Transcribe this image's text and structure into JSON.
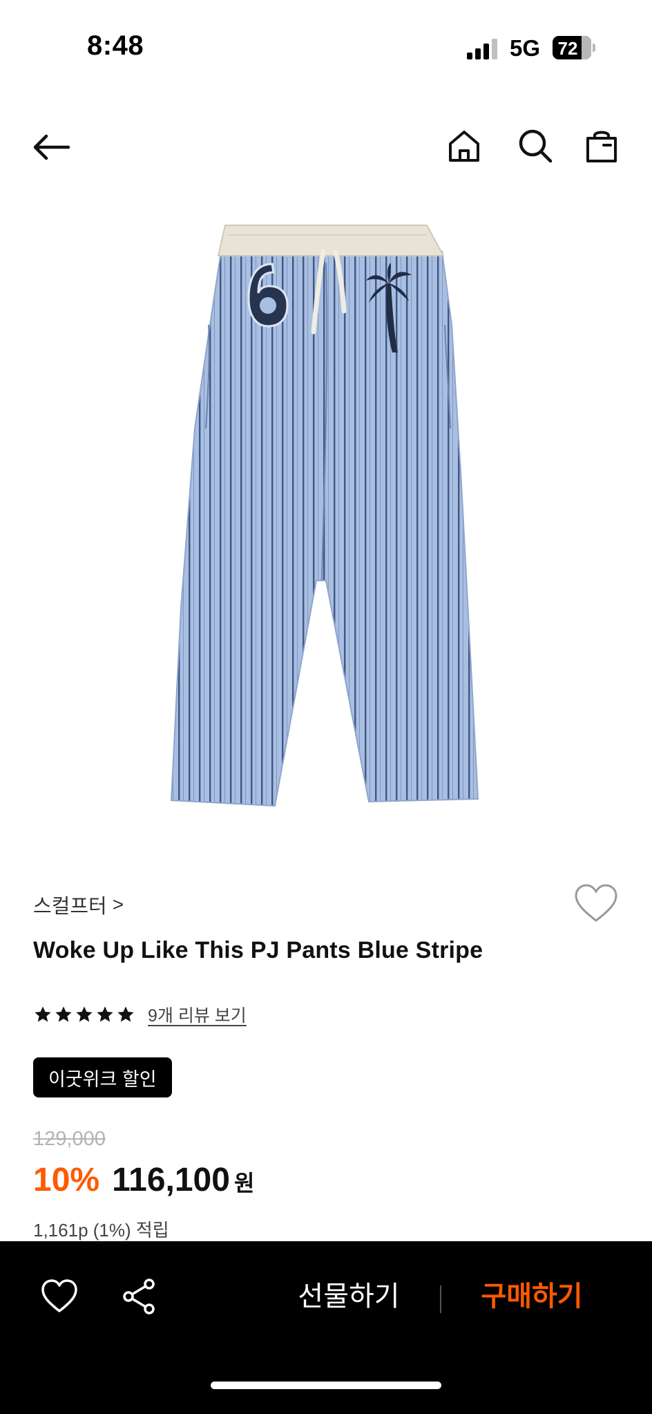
{
  "status_bar": {
    "time": "8:48",
    "network": "5G",
    "battery": "72"
  },
  "nav": {
    "icons": [
      "back-arrow-icon",
      "home-icon",
      "search-icon",
      "shopping-bag-icon"
    ]
  },
  "product": {
    "image_icon": "striped-pajama-pants-image",
    "brand": "스컬프터",
    "brand_chevron": ">",
    "title": "Woke Up Like This PJ Pants Blue Stripe",
    "rating": {
      "stars": 5,
      "review_link": "9개 리뷰 보기"
    },
    "promo_badge": "이굿위크 할인",
    "original_price": "129,000",
    "discount": "10%",
    "sale_price": "116,100",
    "currency": "원",
    "points": "1,161p (1%) 적립"
  },
  "bottom_bar": {
    "gift_label": "선물하기",
    "buy_label": "구매하기",
    "icons": [
      "heart-icon",
      "share-icon"
    ]
  },
  "colors": {
    "accent": "#ff5a00",
    "bar_bg": "#000000",
    "pants_blue": "#9fb7dc",
    "stripe": "#4a5f86"
  }
}
